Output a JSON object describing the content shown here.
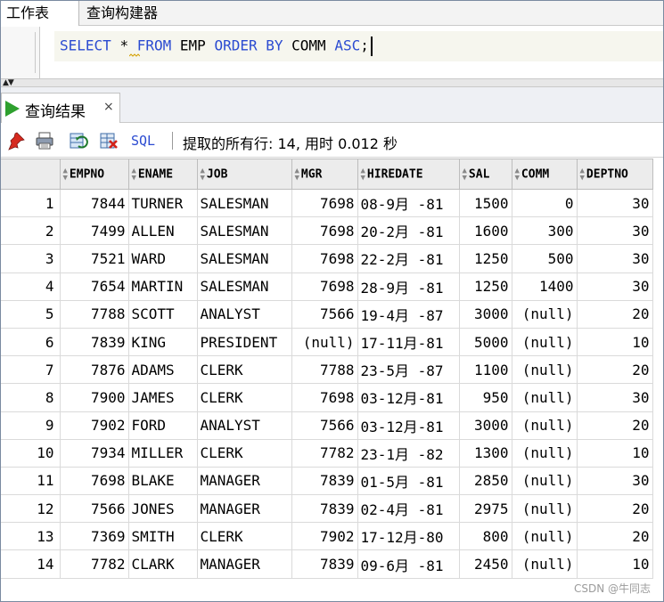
{
  "tabs": [
    {
      "label": "工作表"
    },
    {
      "label": "查询构建器"
    }
  ],
  "editor": {
    "sql": [
      "SELECT",
      "*",
      "FROM",
      "EMP",
      "ORDER",
      "BY",
      "COMM",
      "ASC",
      ";"
    ]
  },
  "result_tab": {
    "label": "查询结果",
    "close": "×"
  },
  "toolbar": {
    "sql_label": "SQL",
    "status": "提取的所有行: 14, 用时 0.012 秒",
    "icons": [
      "pin-icon",
      "print-icon",
      "refresh-icon",
      "export-icon"
    ]
  },
  "grid": {
    "columns": [
      "EMPNO",
      "ENAME",
      "JOB",
      "MGR",
      "HIREDATE",
      "SAL",
      "COMM",
      "DEPTNO"
    ],
    "rows": [
      [
        "1",
        "7844",
        "TURNER",
        "SALESMAN",
        "7698",
        "08-9月 -81",
        "1500",
        "0",
        "30"
      ],
      [
        "2",
        "7499",
        "ALLEN",
        "SALESMAN",
        "7698",
        "20-2月 -81",
        "1600",
        "300",
        "30"
      ],
      [
        "3",
        "7521",
        "WARD",
        "SALESMAN",
        "7698",
        "22-2月 -81",
        "1250",
        "500",
        "30"
      ],
      [
        "4",
        "7654",
        "MARTIN",
        "SALESMAN",
        "7698",
        "28-9月 -81",
        "1250",
        "1400",
        "30"
      ],
      [
        "5",
        "7788",
        "SCOTT",
        "ANALYST",
        "7566",
        "19-4月 -87",
        "3000",
        "(null)",
        "20"
      ],
      [
        "6",
        "7839",
        "KING",
        "PRESIDENT",
        "(null)",
        "17-11月-81",
        "5000",
        "(null)",
        "10"
      ],
      [
        "7",
        "7876",
        "ADAMS",
        "CLERK",
        "7788",
        "23-5月 -87",
        "1100",
        "(null)",
        "20"
      ],
      [
        "8",
        "7900",
        "JAMES",
        "CLERK",
        "7698",
        "03-12月-81",
        "950",
        "(null)",
        "30"
      ],
      [
        "9",
        "7902",
        "FORD",
        "ANALYST",
        "7566",
        "03-12月-81",
        "3000",
        "(null)",
        "20"
      ],
      [
        "10",
        "7934",
        "MILLER",
        "CLERK",
        "7782",
        "23-1月 -82",
        "1300",
        "(null)",
        "10"
      ],
      [
        "11",
        "7698",
        "BLAKE",
        "MANAGER",
        "7839",
        "01-5月 -81",
        "2850",
        "(null)",
        "30"
      ],
      [
        "12",
        "7566",
        "JONES",
        "MANAGER",
        "7839",
        "02-4月 -81",
        "2975",
        "(null)",
        "20"
      ],
      [
        "13",
        "7369",
        "SMITH",
        "CLERK",
        "7902",
        "17-12月-80",
        "800",
        "(null)",
        "20"
      ],
      [
        "14",
        "7782",
        "CLARK",
        "MANAGER",
        "7839",
        "09-6月 -81",
        "2450",
        "(null)",
        "10"
      ]
    ]
  },
  "watermark": "CSDN @牛同志",
  "colors": {
    "keyword": "#2b4bd1",
    "run_icon": "#2ea02e"
  }
}
